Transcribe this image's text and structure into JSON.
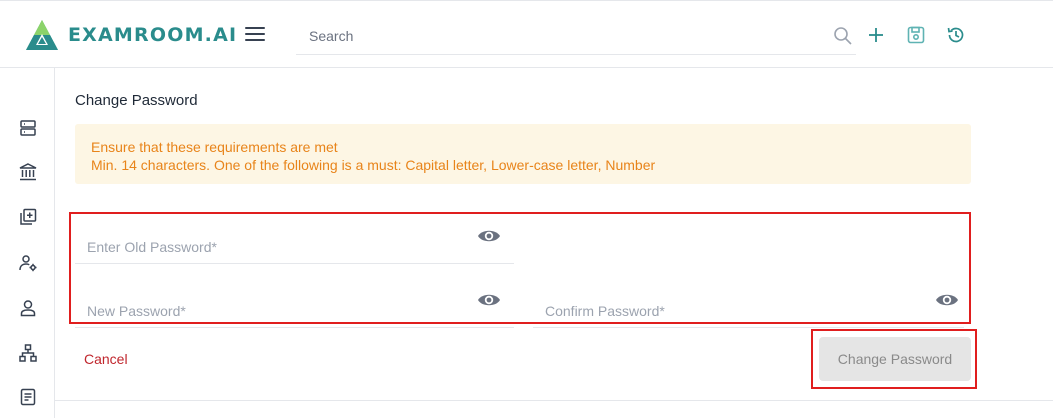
{
  "header": {
    "logo_text": "EXAMROOM.AI",
    "search_placeholder": "Search",
    "icons": [
      "menu-icon",
      "search-icon",
      "add-icon",
      "save-icon",
      "history-icon"
    ]
  },
  "sidebar": {
    "items": [
      {
        "icon": "server-icon"
      },
      {
        "icon": "institution-icon"
      },
      {
        "icon": "add-library-icon"
      },
      {
        "icon": "user-settings-icon"
      },
      {
        "icon": "user-icon"
      },
      {
        "icon": "hierarchy-icon"
      },
      {
        "icon": "document-icon"
      }
    ]
  },
  "main": {
    "title": "Change Password",
    "alert": {
      "heading": "Ensure that these requirements are met",
      "detail": "Min. 14 characters. One of the following is a must: Capital letter, Lower-case letter, Number"
    },
    "form": {
      "old_password_placeholder": "Enter Old Password*",
      "new_password_placeholder": "New Password*",
      "confirm_password_placeholder": "Confirm Password*"
    },
    "cancel_label": "Cancel",
    "submit_label": "Change Password"
  },
  "colors": {
    "brand": "#2a8c8c",
    "alert_bg": "#fdf6e4",
    "alert_text": "#e8841a",
    "cancel_text": "#c0262d",
    "highlight_border": "#e01e1e"
  }
}
